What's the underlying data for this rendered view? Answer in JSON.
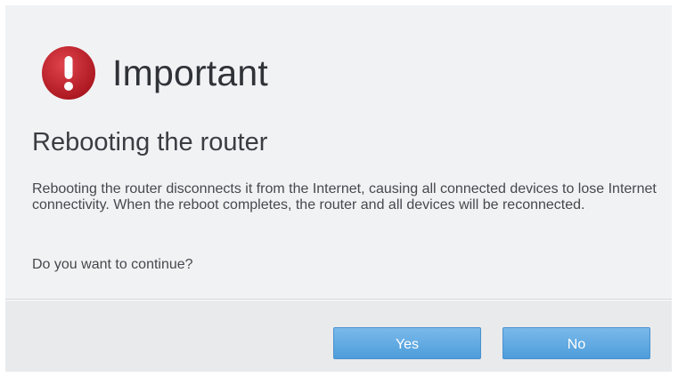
{
  "dialog": {
    "icon": "exclamation-alert-icon",
    "title": "Important",
    "subtitle": "Rebooting the router",
    "message": "Rebooting the router disconnects it from the Internet, causing all connected devices to lose Internet connectivity. When the reboot completes, the router and all devices will be reconnected.",
    "question": "Do you want to continue?",
    "buttons": {
      "yes_label": "Yes",
      "no_label": "No"
    }
  },
  "colors": {
    "alert_red": "#c0202a",
    "button_blue": "#5aa7e2",
    "dialog_bg": "#f1f2f4",
    "footer_bg": "#e9eaec"
  }
}
